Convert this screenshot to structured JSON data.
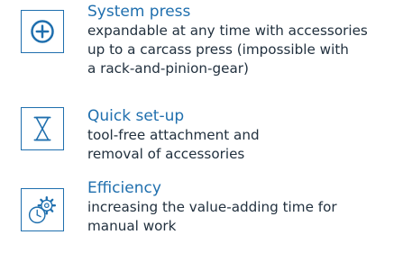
{
  "features": [
    {
      "icon": "plus-circle-icon",
      "title": "System press",
      "lines": [
        "expandable at any time with accessories",
        "up to a carcass press (impossible with",
        "a rack-and-pinion-gear)"
      ]
    },
    {
      "icon": "hourglass-icon",
      "title": "Quick set-up",
      "lines": [
        "tool-free attachment and",
        "removal of accessories"
      ]
    },
    {
      "icon": "gear-clock-icon",
      "title": "Efficiency",
      "lines": [
        "increasing the value-adding time for",
        "manual work"
      ]
    }
  ],
  "colors": {
    "accent": "#1f6fae",
    "text": "#22313f"
  }
}
